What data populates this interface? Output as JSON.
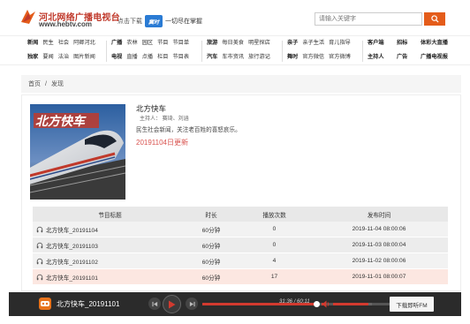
{
  "header": {
    "logo_cn": "河北网络广播电视台",
    "logo_url": "www.hebtv.com",
    "download_text": "点击下载",
    "app_name": "冀时",
    "slogan": "一切尽在掌握",
    "search_placeholder": "请输入关键字",
    "search_icon": "search-icon"
  },
  "nav": {
    "groups": [
      {
        "row1": [
          "新闻",
          "民生",
          "社会",
          "阿卿河北"
        ],
        "row2": [
          "独家",
          "要闻",
          "法治",
          "图片新闻"
        ]
      },
      {
        "row1": [
          "广播",
          "农林",
          "园区",
          "节目",
          "节目单"
        ],
        "row2": [
          "电视",
          "直播",
          "点播",
          "栏目",
          "节目表"
        ]
      },
      {
        "row1": [
          "旅游",
          "每日美食",
          "明星探店"
        ],
        "row2": [
          "汽车",
          "车市资讯",
          "旅行游记"
        ]
      },
      {
        "row1": [
          "亲子",
          "亲子生活",
          "育儿指导"
        ],
        "row2": [
          "舞时",
          "官方微信",
          "官方微博"
        ]
      },
      {
        "row1": [
          "客户端"
        ],
        "row2": [
          "主持人"
        ]
      },
      {
        "row1": [
          "招标"
        ],
        "row2": [
          "广告"
        ]
      },
      {
        "row1": [
          "体彩大直播"
        ],
        "row2": [
          "广播电视报"
        ]
      }
    ]
  },
  "breadcrumb": {
    "home": "首页",
    "separator": "/",
    "current": "发现"
  },
  "program": {
    "cover_text": "北方快车",
    "title": "北方快车",
    "hosts": "主持人：  赛琦、刘涵",
    "description": "民生社会新闻，关注老百姓的喜怒哀乐。",
    "latest": "20191104日更新"
  },
  "table": {
    "headers": [
      "节目标题",
      "时长",
      "播放次数",
      "发布时间"
    ],
    "rows": [
      {
        "title": "北方快车_20191104",
        "duration": "60分钟",
        "plays": "0",
        "date": "2019-11-04 08:00:06"
      },
      {
        "title": "北方快车_20191103",
        "duration": "60分钟",
        "plays": "0",
        "date": "2019-11-03 08:00:04"
      },
      {
        "title": "北方快车_20191102",
        "duration": "60分钟",
        "plays": "4",
        "date": "2019-11-02 08:00:06"
      },
      {
        "title": "北方快车_20191101",
        "duration": "60分钟",
        "plays": "17",
        "date": "2019-11-01 08:00:07"
      }
    ]
  },
  "player": {
    "title": "北方快车_20191101",
    "current_time": "31:36",
    "separator": "/",
    "total_time": "60:11",
    "progress": 0.525,
    "volume": 0.9,
    "download_label": "下载即听FM"
  },
  "colors": {
    "accent": "#d23a2f",
    "search_button": "#e45c1a",
    "latest_text": "#d9534f",
    "active_row": "#fce7e1",
    "player_bg": "#2b2b2b"
  }
}
